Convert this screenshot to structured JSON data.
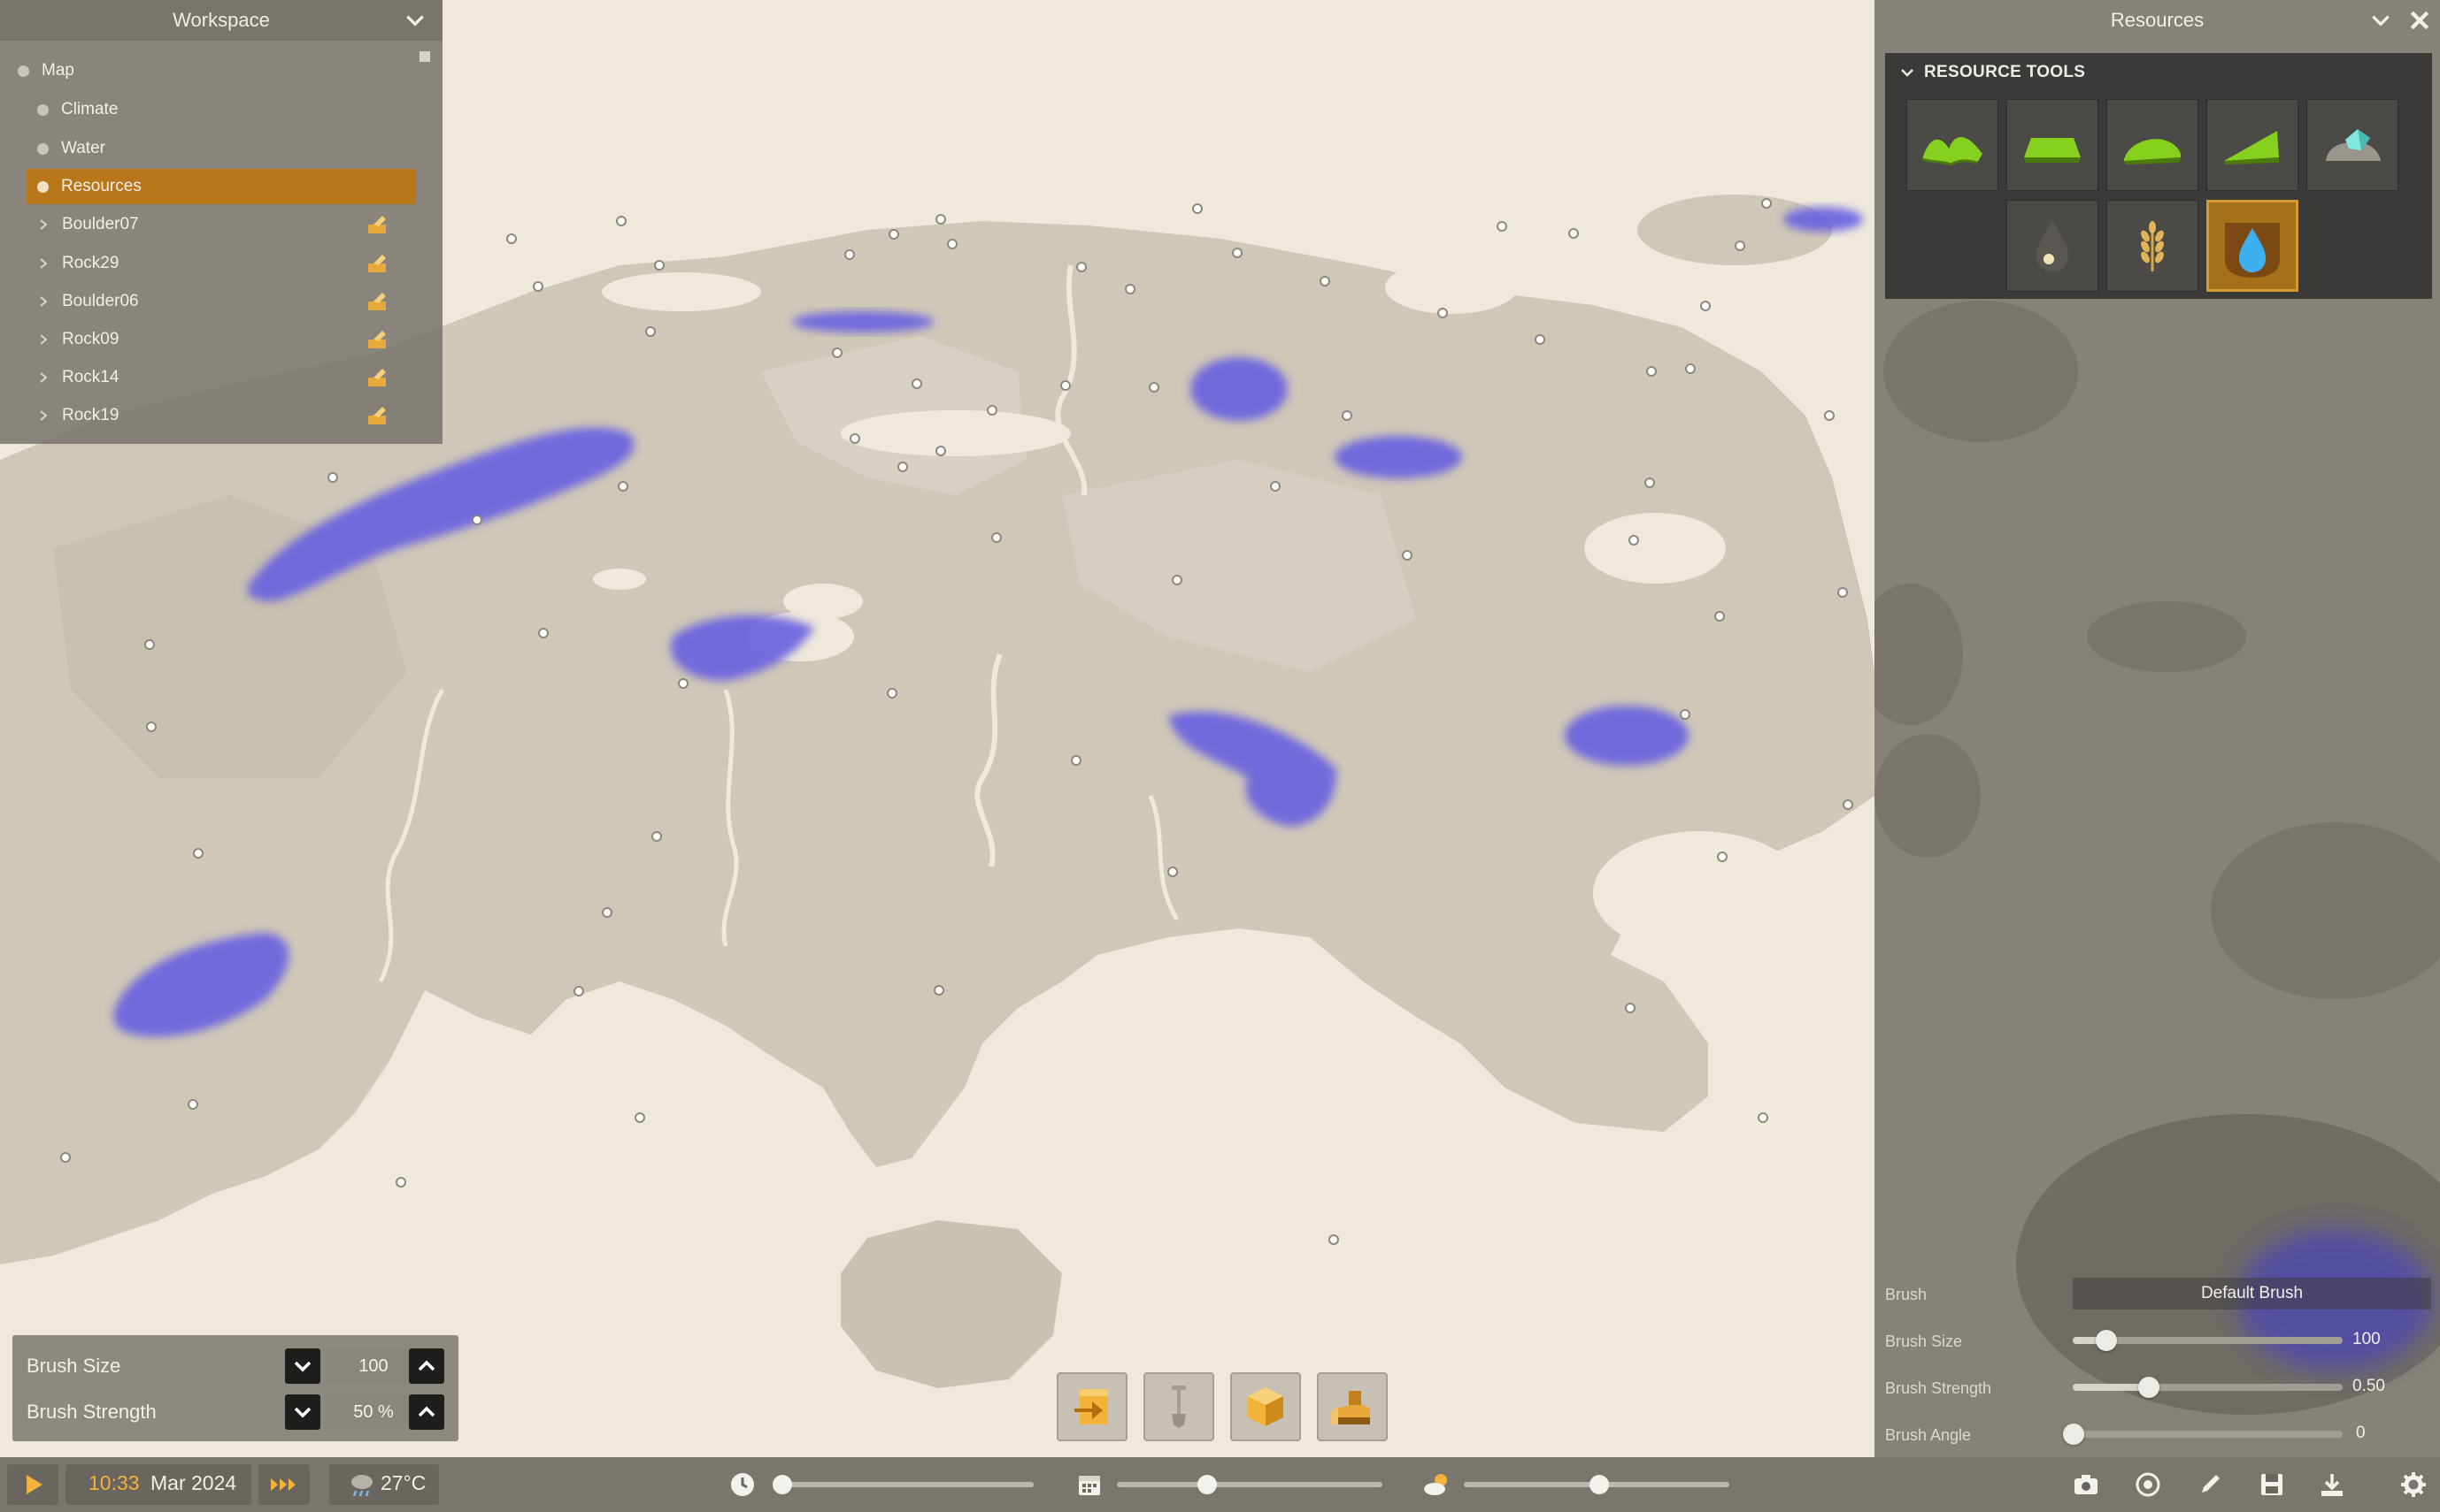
{
  "workspace": {
    "title": "Workspace",
    "items": [
      {
        "label": "Map",
        "level": 0,
        "type": "dot"
      },
      {
        "label": "Climate",
        "level": 1,
        "type": "dot"
      },
      {
        "label": "Water",
        "level": 1,
        "type": "dot"
      },
      {
        "label": "Resources",
        "level": 1,
        "type": "dot",
        "selected": true
      },
      {
        "label": "Boulder07",
        "level": 1,
        "type": "expander"
      },
      {
        "label": "Rock29",
        "level": 1,
        "type": "expander"
      },
      {
        "label": "Boulder06",
        "level": 1,
        "type": "expander"
      },
      {
        "label": "Rock09",
        "level": 1,
        "type": "expander"
      },
      {
        "label": "Rock14",
        "level": 1,
        "type": "expander"
      },
      {
        "label": "Rock19",
        "level": 1,
        "type": "expander"
      }
    ]
  },
  "resources_panel": {
    "title": "Resources",
    "section_title": "RESOURCE TOOLS",
    "tools": [
      {
        "icon": "hills-terrain-icon"
      },
      {
        "icon": "plateau-terrain-icon"
      },
      {
        "icon": "mound-terrain-icon"
      },
      {
        "icon": "slope-terrain-icon"
      },
      {
        "icon": "ore-rock-icon"
      },
      {
        "icon": "oil-drop-icon"
      },
      {
        "icon": "wheat-icon"
      },
      {
        "icon": "water-drop-icon",
        "selected": true
      }
    ],
    "brush_label": "Brush",
    "brush_value": "Default Brush",
    "brush_size_label": "Brush Size",
    "brush_size_value": "100",
    "brush_size_fraction": 0.12,
    "brush_strength_label": "Brush Strength",
    "brush_strength_value": "0.50",
    "brush_strength_fraction": 0.28,
    "brush_angle_label": "Brush Angle",
    "brush_angle_value": "0",
    "brush_angle_fraction": 0.0
  },
  "brush_box": {
    "size_label": "Brush Size",
    "size_value": "100",
    "strength_label": "Brush Strength",
    "strength_value": "50 %"
  },
  "status": {
    "time": "10:33",
    "date": "Mar 2024",
    "temperature": "27°C",
    "time_slider_fraction": 0.02,
    "date_slider_fraction": 0.34,
    "weather_slider_fraction": 0.51
  },
  "colors": {
    "accent": "#b8771a",
    "water": "#6b62e0",
    "land": "#cfc7b8",
    "snow": "#efe9dc"
  }
}
